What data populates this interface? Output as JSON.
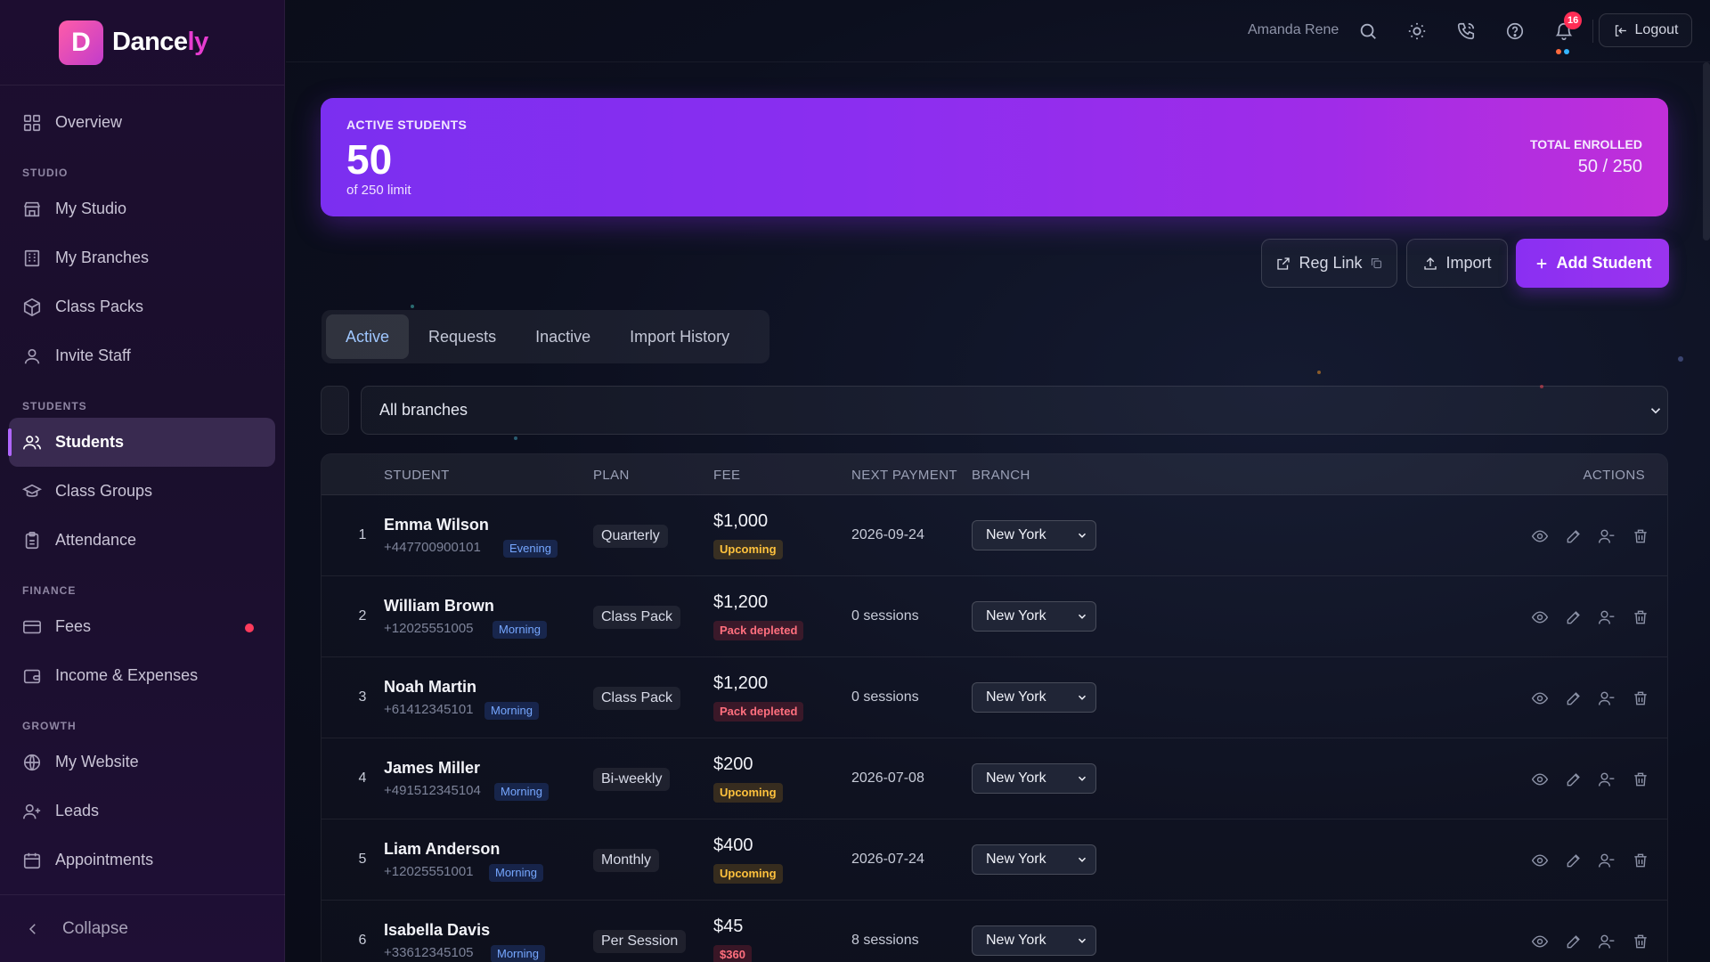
{
  "brand": {
    "logo_letter": "D",
    "name_main": "Dance",
    "name_accent": "ly"
  },
  "sidebar": {
    "overview": "Overview",
    "section_studio": "STUDIO",
    "my_studio": "My Studio",
    "my_branches": "My Branches",
    "class_packs": "Class Packs",
    "invite_staff": "Invite Staff",
    "section_students": "STUDENTS",
    "students": "Students",
    "class_groups": "Class Groups",
    "attendance": "Attendance",
    "section_finance": "FINANCE",
    "fees": "Fees",
    "income_expenses": "Income & Expenses",
    "section_growth": "GROWTH",
    "my_website": "My Website",
    "leads": "Leads",
    "appointments": "Appointments",
    "collapse": "Collapse"
  },
  "topbar": {
    "user_name": "Amanda Rene",
    "notification_count": "16",
    "logout": "Logout"
  },
  "banner": {
    "label": "ACTIVE STUDENTS",
    "count": "50",
    "sublabel": "of 250 limit",
    "total_label": "TOTAL ENROLLED",
    "total_value": "50 / 250"
  },
  "actions": {
    "reg_link": "Reg Link",
    "import": "Import",
    "add_student": "Add Student"
  },
  "tabs": [
    "Active",
    "Requests",
    "Inactive",
    "Import History"
  ],
  "filter": {
    "branch_value": "All branches"
  },
  "table": {
    "headers": {
      "student": "STUDENT",
      "plan": "PLAN",
      "fee": "FEE",
      "next_payment": "NEXT PAYMENT",
      "branch": "BRANCH",
      "actions": "ACTIONS"
    },
    "rows": [
      {
        "num": "1",
        "name": "Emma Wilson",
        "phone": "+447700900101",
        "time": "Evening",
        "plan": "Quarterly",
        "fee": "$1,000",
        "fee_status": "Upcoming",
        "next_payment": "2026-09-24",
        "branch": "New York"
      },
      {
        "num": "2",
        "name": "William Brown",
        "phone": "+12025551005",
        "time": "Morning",
        "plan": "Class Pack",
        "fee": "$1,200",
        "fee_status": "Pack depleted",
        "next_payment": "0 sessions",
        "branch": "New York"
      },
      {
        "num": "3",
        "name": "Noah Martin",
        "phone": "+61412345101",
        "time": "Morning",
        "plan": "Class Pack",
        "fee": "$1,200",
        "fee_status": "Pack depleted",
        "next_payment": "0 sessions",
        "branch": "New York"
      },
      {
        "num": "4",
        "name": "James Miller",
        "phone": "+491512345104",
        "time": "Morning",
        "plan": "Bi-weekly",
        "fee": "$200",
        "fee_status": "Upcoming",
        "next_payment": "2026-07-08",
        "branch": "New York"
      },
      {
        "num": "5",
        "name": "Liam Anderson",
        "phone": "+12025551001",
        "time": "Morning",
        "plan": "Monthly",
        "fee": "$400",
        "fee_status": "Upcoming",
        "next_payment": "2026-07-24",
        "branch": "New York"
      },
      {
        "num": "6",
        "name": "Isabella Davis",
        "phone": "+33612345105",
        "time": "Morning",
        "plan": "Per Session",
        "fee": "$45",
        "fee_status": "$360",
        "next_payment": "8 sessions",
        "branch": "New York"
      }
    ]
  },
  "colors": {
    "accent": "#8a2ff2",
    "brand_pink": "#e63cd0",
    "upcoming": "#ffc23d",
    "depleted": "#ff6f7e",
    "time_tag": "#76a7ff",
    "notification_badge": "#ff2d55"
  }
}
